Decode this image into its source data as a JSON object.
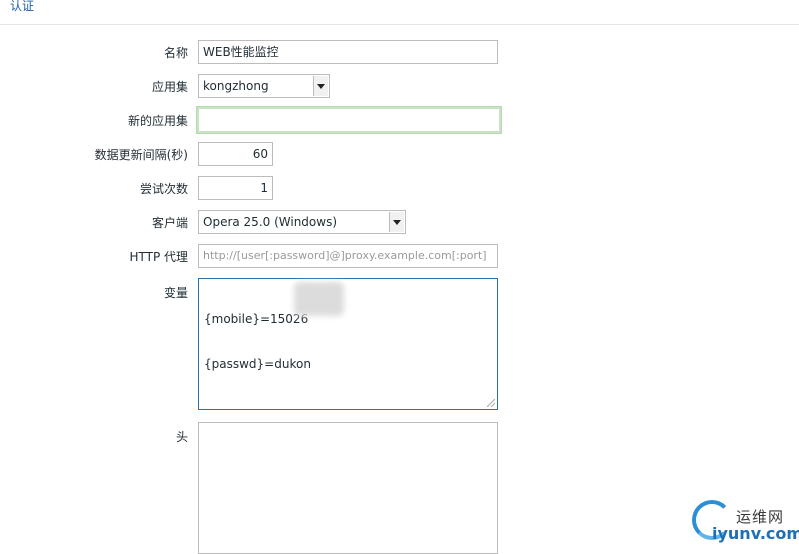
{
  "tabs": {
    "auth": "认证"
  },
  "form": {
    "name": {
      "label": "名称",
      "value": "WEB性能监控"
    },
    "app_set": {
      "label": "应用集",
      "value": "kongzhong"
    },
    "new_app_set": {
      "label": "新的应用集",
      "value": ""
    },
    "interval": {
      "label": "数据更新间隔(秒)",
      "value": "60"
    },
    "retries": {
      "label": "尝试次数",
      "value": "1"
    },
    "client": {
      "label": "客户端",
      "value": "Opera 25.0 (Windows)"
    },
    "http_proxy": {
      "label": "HTTP 代理",
      "placeholder": "http://[user[:password]@]proxy.example.com[:port]"
    },
    "variables": {
      "label": "变量",
      "line1": "{mobile}=15026",
      "line2": "{passwd}=dukon"
    },
    "headers": {
      "label": "头",
      "value": ""
    }
  },
  "watermark": {
    "cn": "运维网",
    "en": "iyunv.com"
  }
}
